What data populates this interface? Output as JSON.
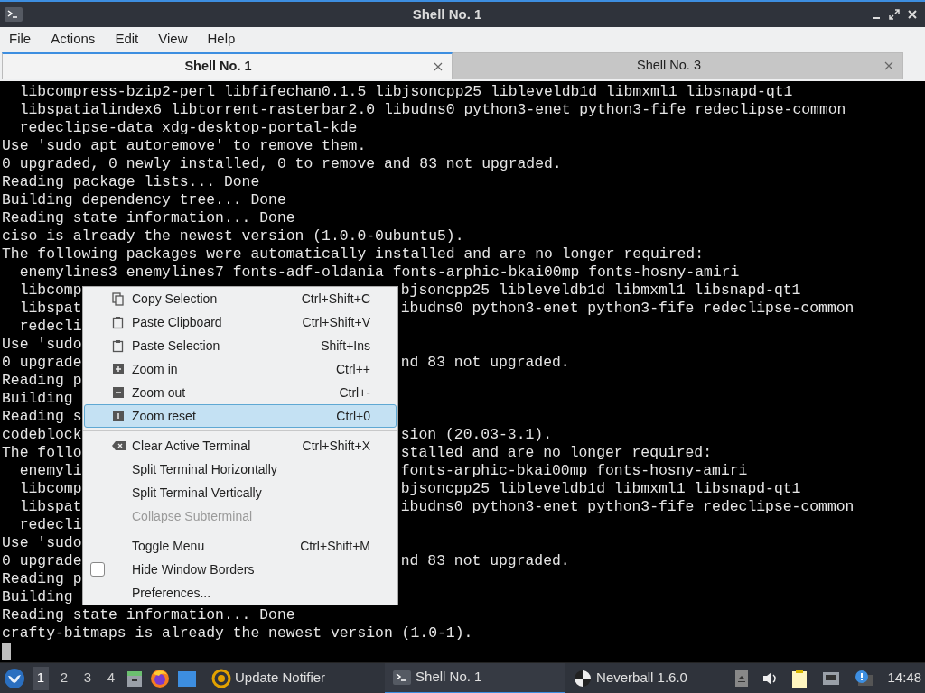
{
  "window": {
    "title": "Shell No. 1"
  },
  "menubar": [
    "File",
    "Actions",
    "Edit",
    "View",
    "Help"
  ],
  "tabs": [
    {
      "label": "Shell No. 1",
      "selected": true
    },
    {
      "label": "Shell No. 3",
      "selected": false
    }
  ],
  "terminal": {
    "lines": [
      {
        "text": "  libcompress-bzip2-perl libfifechan0.1.5 libjsoncpp25 libleveldb1d libmxml1 libsnapd-qt1"
      },
      {
        "text": "  libspatialindex6 libtorrent-rasterbar2.0 libudns0 python3-enet python3-fife redeclipse-common"
      },
      {
        "text": "  redeclipse-data xdg-desktop-portal-kde"
      },
      {
        "text": "Use 'sudo apt autoremove' to remove them."
      },
      {
        "text": "0 upgraded, 0 newly installed, 0 to remove and 83 not upgraded."
      },
      {
        "text": "Reading package lists... Done"
      },
      {
        "text": "Building dependency tree... Done"
      },
      {
        "text": "Reading state information... Done"
      },
      {
        "text": "ciso is already the newest version (1.0.0-0ubuntu5)."
      },
      {
        "text": "The following packages were automatically installed and are no longer required:"
      },
      {
        "text": "  enemylines3 enemylines7 fonts-adf-oldania fonts-arphic-bkai00mp fonts-hosny-amiri"
      },
      {
        "text": "  libcomp",
        "right": "bjsoncpp25 libleveldb1d libmxml1 libsnapd-qt1"
      },
      {
        "text": "  libspat",
        "right": "ibudns0 python3-enet python3-fife redeclipse-common"
      },
      {
        "text": "  redecli"
      },
      {
        "text": "Use 'sudo"
      },
      {
        "text": "0 upgrade",
        "right": "nd 83 not upgraded."
      },
      {
        "text": "Reading p"
      },
      {
        "text": "Building"
      },
      {
        "text": "Reading s"
      },
      {
        "text": "codeblock",
        "right": "sion (20.03-3.1)."
      },
      {
        "text": "The follo",
        "right": "stalled and are no longer required:"
      },
      {
        "text": "  enemyli",
        "right": "fonts-arphic-bkai00mp fonts-hosny-amiri"
      },
      {
        "text": "  libcomp",
        "right": "bjsoncpp25 libleveldb1d libmxml1 libsnapd-qt1"
      },
      {
        "text": "  libspat",
        "right": "ibudns0 python3-enet python3-fife redeclipse-common"
      },
      {
        "text": "  redecli"
      },
      {
        "text": "Use 'sudo"
      },
      {
        "text": "0 upgrade",
        "right": "nd 83 not upgraded."
      },
      {
        "text": "Reading p"
      },
      {
        "text": "Building"
      },
      {
        "text": "Reading state information... Done"
      },
      {
        "text": "crafty-bitmaps is already the newest version (1.0-1)."
      }
    ]
  },
  "context_menu": {
    "groups": [
      [
        {
          "label": "Copy Selection",
          "shortcut": "Ctrl+Shift+C",
          "kind": "copy",
          "selected": false,
          "disabled": false
        },
        {
          "label": "Paste Clipboard",
          "shortcut": "Ctrl+Shift+V",
          "kind": "paste",
          "selected": false,
          "disabled": false
        },
        {
          "label": "Paste Selection",
          "shortcut": "Shift+Ins",
          "kind": "paste",
          "selected": false,
          "disabled": false
        },
        {
          "label": "Zoom in",
          "shortcut": "Ctrl++",
          "kind": "zoomin",
          "selected": false,
          "disabled": false
        },
        {
          "label": "Zoom out",
          "shortcut": "Ctrl+-",
          "kind": "zoomout",
          "selected": false,
          "disabled": false
        },
        {
          "label": "Zoom reset",
          "shortcut": "Ctrl+0",
          "kind": "zoomreset",
          "selected": true,
          "disabled": false
        }
      ],
      [
        {
          "label": "Clear Active Terminal",
          "shortcut": "Ctrl+Shift+X",
          "kind": "clear",
          "selected": false,
          "disabled": false
        },
        {
          "label": "Split Terminal Horizontally",
          "selected": false,
          "disabled": false
        },
        {
          "label": "Split Terminal Vertically",
          "selected": false,
          "disabled": false
        },
        {
          "label": "Collapse Subterminal",
          "selected": false,
          "disabled": true
        }
      ],
      [
        {
          "label": "Toggle Menu",
          "shortcut": "Ctrl+Shift+M",
          "selected": false,
          "disabled": false
        },
        {
          "label": "Hide Window Borders",
          "checked": false,
          "selected": false,
          "disabled": false
        },
        {
          "label": "Preferences...",
          "selected": false,
          "disabled": false
        }
      ]
    ]
  },
  "taskbar": {
    "workspaces": [
      {
        "label": "1",
        "selected": true
      },
      {
        "label": "2",
        "selected": false
      },
      {
        "label": "3",
        "selected": false
      },
      {
        "label": "4",
        "selected": false
      }
    ],
    "tasks": [
      {
        "label": "Update Notifier",
        "kind": "update",
        "selected": false
      },
      {
        "label": "Shell No. 1",
        "kind": "terminal",
        "selected": true
      },
      {
        "label": "Neverball 1.6.0",
        "kind": "ball",
        "selected": false
      }
    ],
    "clock": "14:48"
  }
}
